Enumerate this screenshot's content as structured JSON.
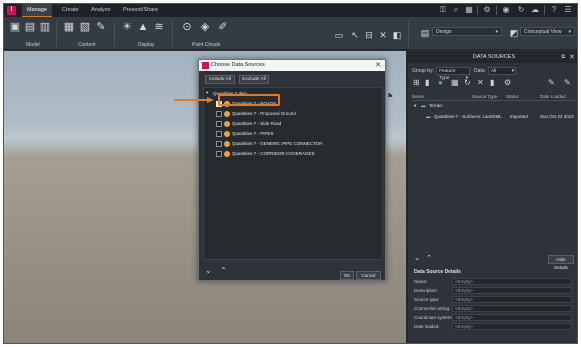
{
  "app": {
    "logo": "I"
  },
  "tabs": [
    {
      "label": "Manage",
      "active": true
    },
    {
      "label": "Create",
      "active": false
    },
    {
      "label": "Analyze",
      "active": false
    },
    {
      "label": "Present/Share",
      "active": false
    }
  ],
  "ribbon": {
    "groups": [
      "Model",
      "Content",
      "Display",
      "Point Clouds"
    ],
    "design_dropdown": "Design",
    "view_dropdown": "Conceptual View"
  },
  "data_sources_panel": {
    "title": "DATA SOURCES",
    "group_by_label": "Group by:",
    "group_by_value": "Feature Type",
    "data_label": "Data:",
    "data_value": "All",
    "columns": [
      "Name",
      "Source Type",
      "Status",
      "Date Loaded"
    ],
    "tree_root": "Terrain",
    "rows": [
      {
        "name": "Quantities-7 - Surfaces: LandXML",
        "source_type": "LandXML",
        "status": "Imported",
        "date": "Sun Oct 22 2023"
      }
    ],
    "hide_details": "Hide Details",
    "details_title": "Data Source Details",
    "details": [
      {
        "key": "Name:",
        "value": "<Empty>"
      },
      {
        "key": "Description:",
        "value": "<Empty>"
      },
      {
        "key": "Source type:",
        "value": "<Empty>"
      },
      {
        "key": "Connection string:",
        "value": "<Empty>"
      },
      {
        "key": "Coordinate system:",
        "value": "<Empty>"
      },
      {
        "key": "Date loaded:",
        "value": "<Empty>"
      }
    ]
  },
  "dialog": {
    "title": "Choose Data Sources",
    "include_all": "Include All",
    "exclude_all": "Exclude All",
    "root": "Quantities-7.dwg",
    "items": [
      {
        "label": "Quantities-7 - ROADS",
        "checked": true
      },
      {
        "label": "Quantities-7 - Proposed Ground",
        "checked": false
      },
      {
        "label": "Quantities-7 - Side Road",
        "checked": false
      },
      {
        "label": "Quantities-7 - PIPES",
        "checked": false
      },
      {
        "label": "Quantities-7 - GENERIC PIPE CONNECTOR",
        "checked": false
      },
      {
        "label": "Quantities-7 - CORRIDOR COVERAGES",
        "checked": false
      }
    ],
    "ok": "OK",
    "cancel": "Cancel"
  },
  "colors": {
    "accent": "#e57a1f",
    "brand": "#c2185b"
  }
}
